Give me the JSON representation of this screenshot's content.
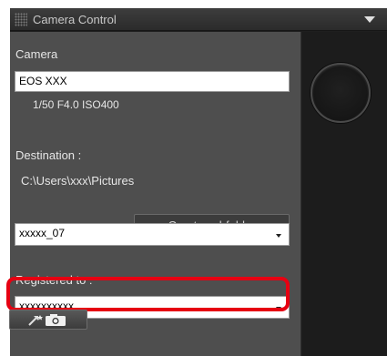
{
  "panel": {
    "title": "Camera Control",
    "camera_label": "Camera",
    "camera_name": "EOS XXX",
    "exposure": "1/50  F4.0  ISO400",
    "destination_label": "Destination :",
    "destination_path": "C:\\Users\\xxx\\Pictures",
    "create_subfolder_label": "Create subfolder",
    "subfolder_value": "xxxxx_07",
    "registered_label": "Registered to :",
    "registered_value": "xxxxxxxxxx"
  },
  "colors": {
    "highlight": "#e60012",
    "panel_bg": "#4e4e4e",
    "dark_bg": "#1f1f1f"
  },
  "icons": [
    "grip-icon",
    "collapse-triangle-icon",
    "register-camera-icon",
    "dropdown-arrow-icon"
  ]
}
